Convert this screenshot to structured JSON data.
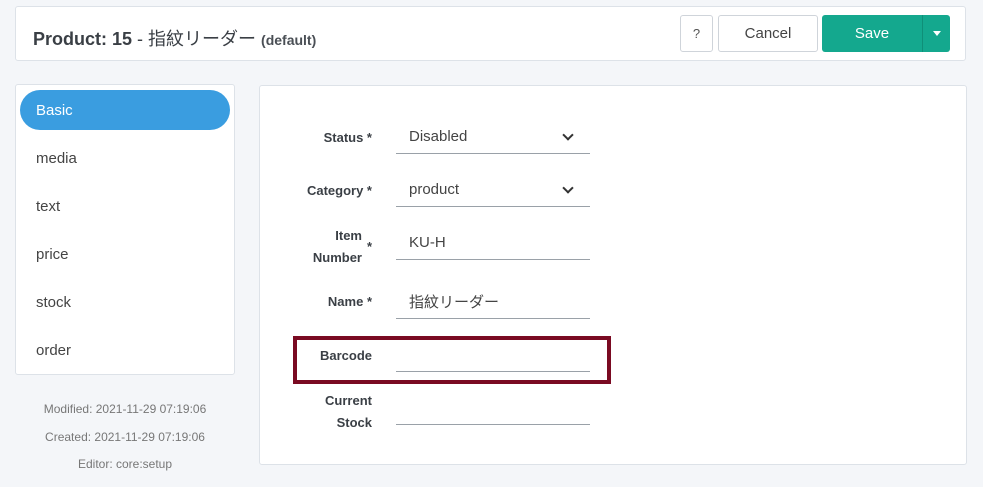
{
  "header": {
    "title_prefix": "Product: 15",
    "title_sep": " - ",
    "title_name": "指紋リーダー",
    "title_scope": "(default)",
    "help_label": "?",
    "cancel_label": "Cancel",
    "save_label": "Save"
  },
  "sidebar": {
    "items": [
      {
        "label": "Basic",
        "active": true
      },
      {
        "label": "media"
      },
      {
        "label": "text"
      },
      {
        "label": "price"
      },
      {
        "label": "stock"
      },
      {
        "label": "order"
      }
    ]
  },
  "meta": {
    "modified": "Modified: 2021-11-29 07:19:06",
    "created": "Created: 2021-11-29 07:19:06",
    "editor": "Editor: core:setup"
  },
  "form": {
    "status_label": "Status *",
    "status_value": "Disabled",
    "category_label": "Category *",
    "category_value": "product",
    "item_number_label_1": "Item",
    "item_number_label_2": "Number",
    "item_number_star": "*",
    "item_number_value": "KU-H",
    "name_label": "Name *",
    "name_value": "指紋リーダー",
    "barcode_label": "Barcode",
    "barcode_value": "",
    "current_stock_label_1": "Current",
    "current_stock_label_2": "Stock",
    "current_stock_value": ""
  },
  "colors": {
    "accent": "#3a9de0",
    "save": "#14a88e",
    "highlight": "#7a0a22"
  }
}
